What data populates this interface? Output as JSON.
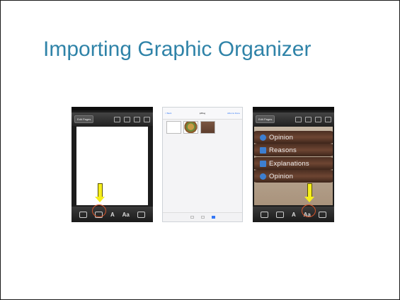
{
  "slide": {
    "title": "Importing Graphic Organizer"
  },
  "screen1": {
    "edit_pages_label": "Edit Pages",
    "bottom_text_label": "Aa"
  },
  "screen2": {
    "back_label": "< Back",
    "title": "ipBlog",
    "right_label": "Albums  Done"
  },
  "screen3": {
    "edit_pages_label": "Edit Pages",
    "bottom_text_label": "Aa",
    "bands": [
      "Opinion",
      "Reasons",
      "Explanations",
      "Opinion"
    ]
  },
  "colors": {
    "title": "#2f83a8",
    "arrow": "#f6ee1c",
    "highlight_circle": "#d2532a"
  }
}
